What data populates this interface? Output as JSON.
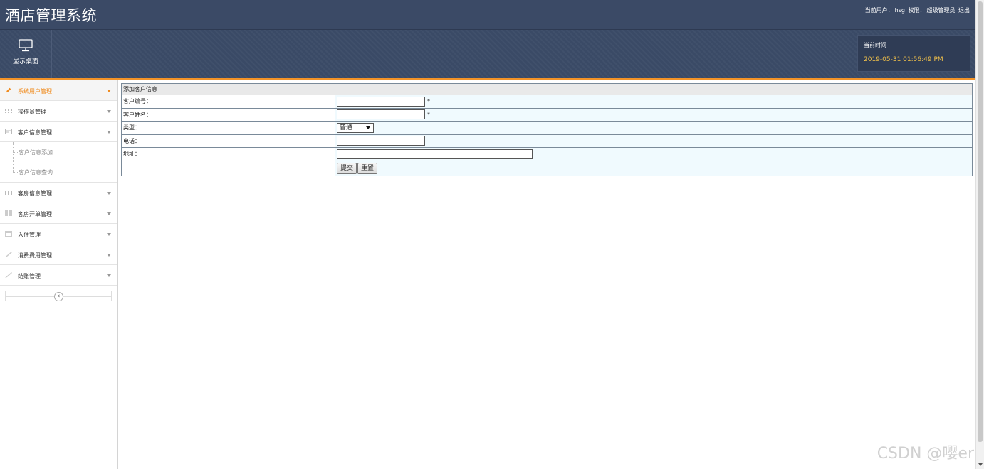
{
  "header": {
    "app_title": "酒店管理系统",
    "user_label": "当前用户：",
    "user_name": "hsg",
    "role_label": "权限：",
    "role_name": "超级管理员",
    "logout": "退出"
  },
  "toolbar": {
    "desktop_label": "显示桌面",
    "time_title": "当前时间",
    "time_value": "2019-05-31 01:56:49 PM"
  },
  "sidebar": {
    "items": [
      {
        "label": "系统用户管理",
        "icon": "pencil-icon",
        "active": true
      },
      {
        "label": "操作员管理",
        "icon": "grid-icon"
      },
      {
        "label": "客户信息管理",
        "icon": "card-icon"
      },
      {
        "label": "客房信息管理",
        "icon": "grid-icon"
      },
      {
        "label": "客房开单管理",
        "icon": "columns-icon"
      },
      {
        "label": "入住管理",
        "icon": "calendar-icon"
      },
      {
        "label": "消费费用管理",
        "icon": "brush-icon"
      },
      {
        "label": "结账管理",
        "icon": "brush-icon"
      }
    ],
    "subitems": [
      "客户信息添加",
      "客户信息查询"
    ],
    "collapse_glyph": "‹"
  },
  "form": {
    "title": "添加客户信息",
    "rows": {
      "code_label": "客户编号：",
      "code_value": "",
      "name_label": "客户姓名：",
      "name_value": "",
      "type_label": "类型：",
      "type_selected": "普通",
      "phone_label": "电话：",
      "phone_value": "",
      "address_label": "地址：",
      "address_value": ""
    },
    "required_mark": "*",
    "submit": "提交",
    "reset": "重置"
  },
  "watermark": "CSDN @嘤er",
  "colors": {
    "header_bg": "#3b4a66",
    "accent": "#f39327",
    "time_text": "#f3c24a",
    "active_menu": "#f08a1c",
    "row_bg": "#f0fafe"
  }
}
